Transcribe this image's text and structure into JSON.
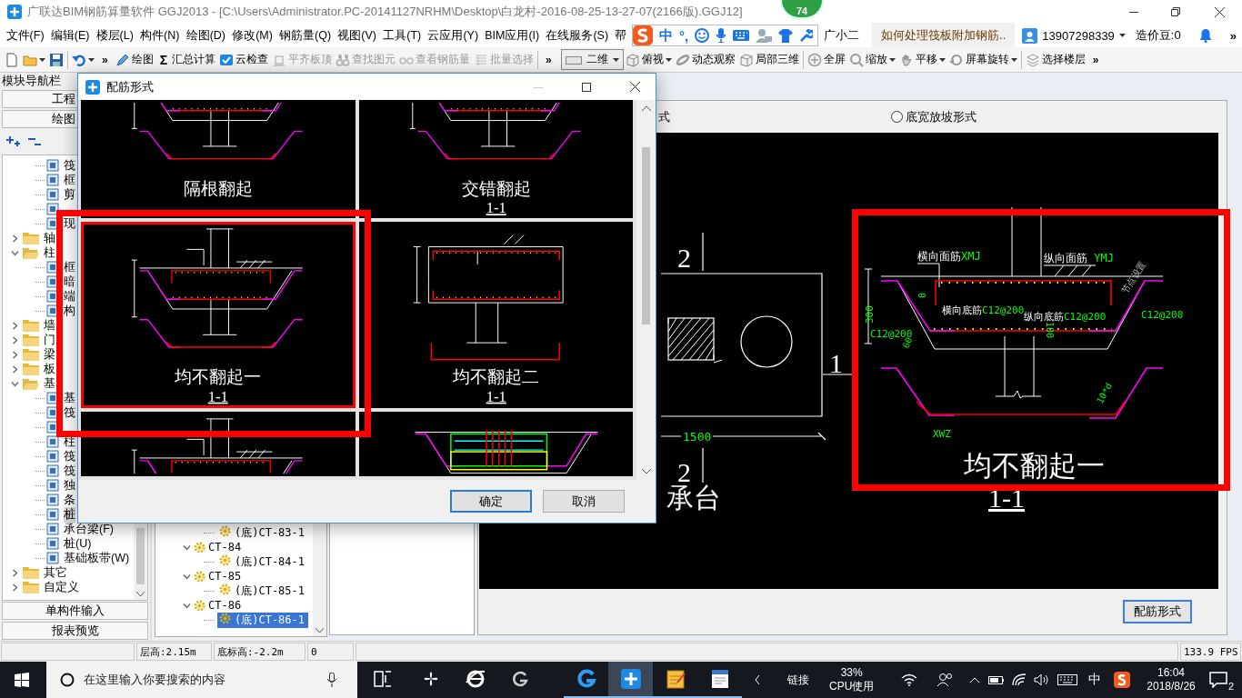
{
  "window": {
    "title": "广联达BIM钢筋算量软件 GGJ2013 - [C:\\Users\\Administrator.PC-20141127NRHM\\Desktop\\白龙村-2016-08-25-13-27-07(2166版).GGJ12]"
  },
  "badge": {
    "count": "74"
  },
  "menu": [
    "文件(F)",
    "编辑(E)",
    "楼层(L)",
    "构件(N)",
    "绘图(D)",
    "修改(M)",
    "钢筋量(Q)",
    "视图(V)",
    "工具(T)",
    "云应用(Y)",
    "BIM应用(I)",
    "在线服务(S)",
    "帮"
  ],
  "ime_bar": {
    "mode": "中",
    "punctuation": "°,"
  },
  "assistant": {
    "label": "广小二"
  },
  "news": {
    "text": "如何处理筏板附加钢筋.."
  },
  "account": {
    "phone": "13907298339",
    "beans": "造价豆:0",
    "overflow": "»"
  },
  "toolbar": [
    {
      "kind": "button",
      "disabled": false,
      "dropdown": false
    },
    {
      "kind": "button",
      "disabled": false,
      "dropdown": true
    },
    {
      "kind": "button",
      "disabled": false,
      "dropdown": false
    },
    {
      "kind": "button",
      "disabled": false,
      "dropdown": true
    },
    {
      "kind": "overflow",
      "label": "»"
    },
    {
      "kind": "button",
      "label": "绘图",
      "disabled": false,
      "dropdown": false
    },
    {
      "kind": "button",
      "glyph": "Σ",
      "label": "汇总计算",
      "disabled": false,
      "dropdown": false
    },
    {
      "kind": "button",
      "label": "云检查",
      "disabled": false,
      "dropdown": false
    },
    {
      "kind": "button",
      "label": "平齐板顶",
      "disabled": true,
      "dropdown": false
    },
    {
      "kind": "button",
      "label": "查找图元",
      "disabled": true,
      "dropdown": false
    },
    {
      "kind": "button",
      "label": "查看钢筋量",
      "disabled": true,
      "dropdown": false
    },
    {
      "kind": "button",
      "label": "批量选择",
      "disabled": true,
      "dropdown": false
    },
    {
      "kind": "overflow",
      "label": "»"
    },
    {
      "kind": "combo",
      "label": "二维"
    },
    {
      "kind": "button",
      "label": "俯视",
      "disabled": false,
      "dropdown": true
    },
    {
      "kind": "button",
      "label": "动态观察",
      "disabled": false,
      "dropdown": false
    },
    {
      "kind": "button",
      "label": "局部三维",
      "disabled": false,
      "dropdown": false
    },
    {
      "kind": "button",
      "label": "全屏",
      "disabled": false,
      "dropdown": false
    },
    {
      "kind": "button",
      "label": "缩放",
      "disabled": false,
      "dropdown": true
    },
    {
      "kind": "button",
      "label": "平移",
      "disabled": false,
      "dropdown": true
    },
    {
      "kind": "button",
      "label": "屏幕旋转",
      "disabled": false,
      "dropdown": true
    },
    {
      "kind": "button",
      "label": "选择楼层",
      "disabled": false,
      "dropdown": false
    },
    {
      "kind": "overflow",
      "label": "»"
    }
  ],
  "nav": {
    "title": "模块导航栏",
    "tabs": [
      "工程",
      "绘图"
    ],
    "tree": [
      {
        "children": [
          {
            "label": "筏",
            "selected": false
          },
          {
            "label": "框",
            "selected": false
          },
          {
            "label": "剪",
            "selected": false
          },
          {
            "selected": false
          },
          {
            "label": "现",
            "selected": false
          }
        ]
      },
      {
        "label": "轴",
        "expanded": false,
        "selected": false
      },
      {
        "label": "柱",
        "expanded": true,
        "selected": false,
        "children": [
          {
            "label": "框",
            "selected": false
          },
          {
            "label": "暗",
            "selected": false
          },
          {
            "label": "端",
            "selected": false
          },
          {
            "label": "构",
            "selected": false
          }
        ]
      },
      {
        "label": "墙",
        "expanded": false,
        "selected": false
      },
      {
        "label": "门",
        "expanded": false,
        "selected": false
      },
      {
        "label": "梁",
        "expanded": false,
        "selected": false
      },
      {
        "label": "板",
        "expanded": false,
        "selected": false
      },
      {
        "label": "基",
        "expanded": true,
        "selected": false,
        "children": [
          {
            "label": "基",
            "selected": false
          },
          {
            "label": "筏",
            "selected": false
          },
          {
            "selected": false
          },
          {
            "label": "柱",
            "selected": false
          },
          {
            "label": "筏",
            "selected": false
          },
          {
            "label": "筏",
            "selected": false
          },
          {
            "label": "独",
            "selected": false
          },
          {
            "label": "条",
            "selected": false
          },
          {
            "label": "桩",
            "selected": true
          },
          {
            "label": "承台梁(F)",
            "selected": false
          },
          {
            "label": "桩(U)",
            "selected": false
          },
          {
            "label": "基础板带(W)",
            "selected": false
          }
        ]
      },
      {
        "label": "其它",
        "expanded": false,
        "selected": false
      },
      {
        "label": "自定义",
        "expanded": false,
        "selected": false
      }
    ],
    "footer": [
      "单构件输入",
      "报表预览"
    ]
  },
  "objects": [
    {
      "children": [
        {
          "label": "(底)CT-83-1",
          "selected": false
        }
      ]
    },
    {
      "label": "CT-84",
      "expanded": true,
      "selected": false,
      "children": [
        {
          "label": "(底)CT-84-1",
          "selected": false
        }
      ]
    },
    {
      "label": "CT-85",
      "expanded": true,
      "selected": false,
      "children": [
        {
          "label": "(底)CT-85-1",
          "selected": false
        }
      ]
    },
    {
      "label": "CT-86",
      "expanded": true,
      "selected": false,
      "children": [
        {
          "label": "(底)CT-86-1",
          "selected": true
        }
      ]
    }
  ],
  "work": {
    "option_fragment": "式",
    "options": [
      {
        "label": "底宽放坡形式",
        "selected": false
      }
    ],
    "plan": {
      "axis_labels": [
        "2",
        "1",
        "2"
      ],
      "dimension": "1500",
      "title": "承台"
    },
    "section": {
      "labels": [
        {
          "text": "横向面筋",
          "code": "XMJ"
        },
        {
          "text": "纵向面筋",
          "code": " YMJ"
        },
        {
          "text": "节点设置"
        },
        {
          "code": "0"
        },
        {
          "text": "横向底筋",
          "code": "C12@200"
        },
        {
          "text": "纵向底筋",
          "code": "C12@200"
        },
        {
          "code": "C12@200"
        },
        {
          "code": "300"
        },
        {
          "code": "C12@200"
        },
        {
          "code": "60"
        },
        {
          "code": "100"
        },
        {
          "code": "10*d"
        },
        {
          "code": "XWZ"
        }
      ],
      "caption": "均不翻起一",
      "section": "1-1"
    },
    "button": "配筋形式"
  },
  "dialog": {
    "title": "配筋形式",
    "thumbnails": [
      {
        "kind": "trapezoid",
        "caption": "隔根翻起",
        "selected": false
      },
      {
        "kind": "trapezoid",
        "caption": "交错翻起",
        "section": "1-1",
        "selected": false
      },
      {
        "kind": "trapezoid",
        "caption": "均不翻起一",
        "section": "1-1",
        "selected": true
      },
      {
        "kind": "box",
        "caption": "均不翻起二",
        "section": "1-1",
        "selected": false
      },
      {
        "kind": "trapezoid",
        "selected": false
      },
      {
        "kind": "layered",
        "selected": false
      }
    ],
    "buttons": [
      {
        "label": "确定",
        "default": true
      },
      {
        "label": "取消",
        "default": false
      }
    ]
  },
  "status_bar": [
    "层高:2.15m",
    "底标高:-2.2m",
    "0",
    "133.9 FPS"
  ],
  "taskbar": {
    "search_placeholder": "在这里输入你要搜索的内容",
    "apps": [
      {
        "running": false,
        "active": false
      },
      {
        "running": false,
        "active": false
      },
      {
        "running": false,
        "active": false
      },
      {
        "running": true,
        "active": false
      },
      {
        "running": true,
        "active": true
      },
      {
        "running": true,
        "active": false
      },
      {
        "running": true,
        "active": false
      }
    ],
    "tray": {
      "links": "链接",
      "cpu": "33%",
      "cpu_label": "CPU使用",
      "ime": "中",
      "time": "16:04",
      "date": "2018/8/26",
      "notifications": "2"
    }
  }
}
